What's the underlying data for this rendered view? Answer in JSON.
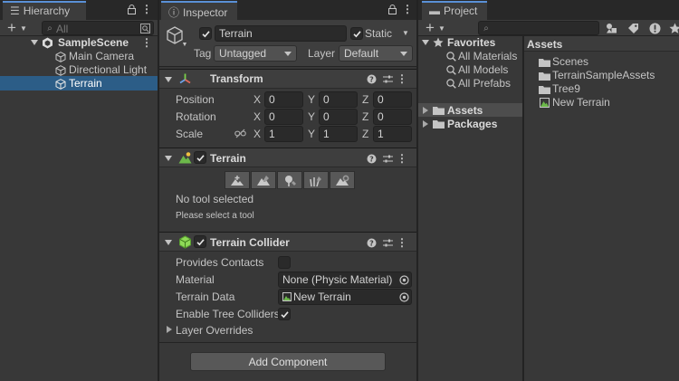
{
  "hierarchy": {
    "tab_label": "Hierarchy",
    "search_placeholder": "All",
    "scene_name": "SampleScene",
    "items": [
      "Main Camera",
      "Directional Light",
      "Terrain"
    ]
  },
  "inspector": {
    "tab_label": "Inspector",
    "object_name": "Terrain",
    "static_label": "Static",
    "tag_label": "Tag",
    "tag_value": "Untagged",
    "layer_label": "Layer",
    "layer_value": "Default",
    "transform": {
      "title": "Transform",
      "position_label": "Position",
      "rotation_label": "Rotation",
      "scale_label": "Scale",
      "axis_x": "X",
      "axis_y": "Y",
      "axis_z": "Z",
      "position": [
        "0",
        "0",
        "0"
      ],
      "rotation": [
        "0",
        "0",
        "0"
      ],
      "scale": [
        "1",
        "1",
        "1"
      ]
    },
    "terrain": {
      "title": "Terrain",
      "status": "No tool selected",
      "hint": "Please select a tool"
    },
    "collider": {
      "title": "Terrain Collider",
      "provides_contacts_label": "Provides Contacts",
      "material_label": "Material",
      "material_value": "None (Physic Material)",
      "terrain_data_label": "Terrain Data",
      "terrain_data_value": "New Terrain",
      "enable_tree_label": "Enable Tree Colliders",
      "layer_overrides_label": "Layer Overrides"
    },
    "add_component_label": "Add Component"
  },
  "project": {
    "tab_label": "Project",
    "favorites_label": "Favorites",
    "favorites": [
      "All Materials",
      "All Models",
      "All Prefabs"
    ],
    "tree": [
      "Assets",
      "Packages"
    ],
    "assets_header": "Assets",
    "asset_items": [
      "Scenes",
      "TerrainSampleAssets",
      "Tree9",
      "New Terrain"
    ]
  },
  "colors": {
    "selection": "#2c5d87",
    "tab_accent": "#5a90d6",
    "panel_bg": "#383838"
  }
}
